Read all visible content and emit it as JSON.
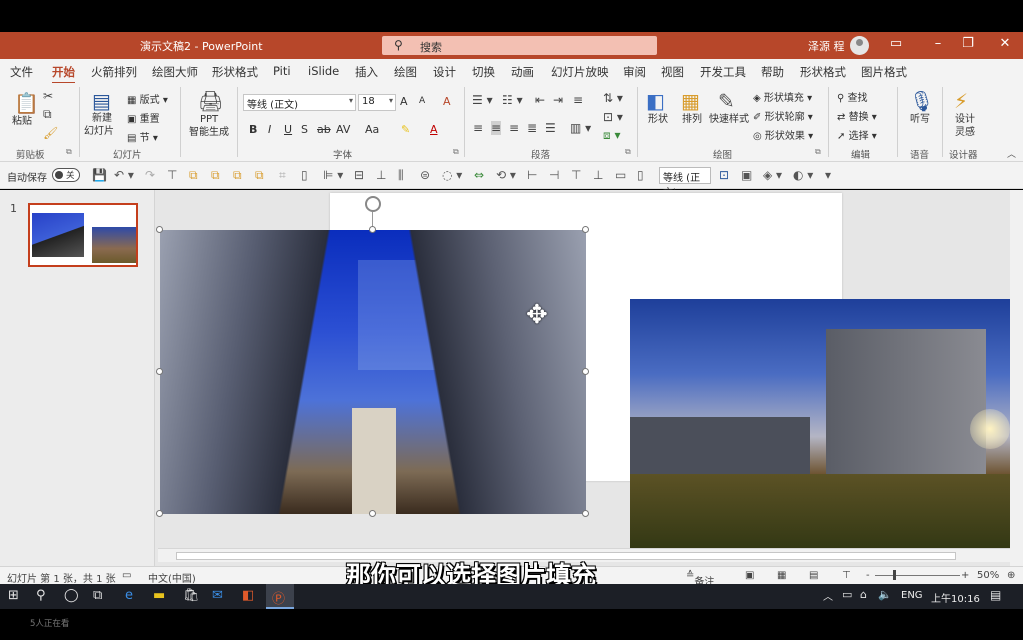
{
  "titlebar": {
    "doc_title": "演示文稿2 - PowerPoint",
    "search_label": "搜索",
    "user_name": "泽源 程"
  },
  "tabs": [
    "文件",
    "开始",
    "火箭排列",
    "绘图大师",
    "形状格式",
    "Piti",
    "iSlide",
    "插入",
    "绘图",
    "设计",
    "切换",
    "动画",
    "幻灯片放映",
    "审阅",
    "视图",
    "开发工具",
    "帮助",
    "形状格式",
    "图片格式"
  ],
  "active_tab_index": 1,
  "ribbon": {
    "clipboard": {
      "paste": "粘贴",
      "label": "剪贴板"
    },
    "slides": {
      "new_slide_l1": "新建",
      "new_slide_l2": "幻灯片",
      "layout": "版式",
      "reset": "重置",
      "section": "节",
      "label": "幻灯片"
    },
    "ppt": {
      "l1": "PPT",
      "l2": "智能生成"
    },
    "font": {
      "font_name": "等线 (正文)",
      "font_size": "18",
      "label": "字体",
      "bold": "B",
      "italic": "I",
      "underline": "U",
      "shadow": "S",
      "strike": "ab",
      "spacing": "AV",
      "case": "Aa",
      "grow": "A",
      "shrink": "A",
      "clear": "A",
      "color": "A"
    },
    "paragraph": {
      "label": "段落"
    },
    "drawing": {
      "shape": "形状",
      "arrange": "排列",
      "quick_style": "快速样式",
      "fill": "形状填充",
      "outline": "形状轮廓",
      "effects": "形状效果",
      "label": "绘图"
    },
    "editing": {
      "find": "查找",
      "replace": "替换",
      "select": "选择",
      "label": "编辑"
    },
    "voice": {
      "dictate": "听写",
      "label": "语音"
    },
    "designer": {
      "l1": "设计",
      "l2": "灵感",
      "label": "设计器"
    }
  },
  "qat": {
    "autosave": "自动保存",
    "toggle": "关",
    "font": "等线 (正文)"
  },
  "thumbnails": [
    {
      "number": "1"
    }
  ],
  "status": {
    "slide_info": "幻灯片 第 1 张，共 1 张",
    "language": "中文(中国)",
    "notes": "备注",
    "zoom": "50%",
    "minus": "-",
    "plus": "+"
  },
  "subtitle": "那你可以选择图片填充",
  "taskbar": {
    "lang": "ENG",
    "time": "上午10:16"
  },
  "viewers": "5人正在看"
}
